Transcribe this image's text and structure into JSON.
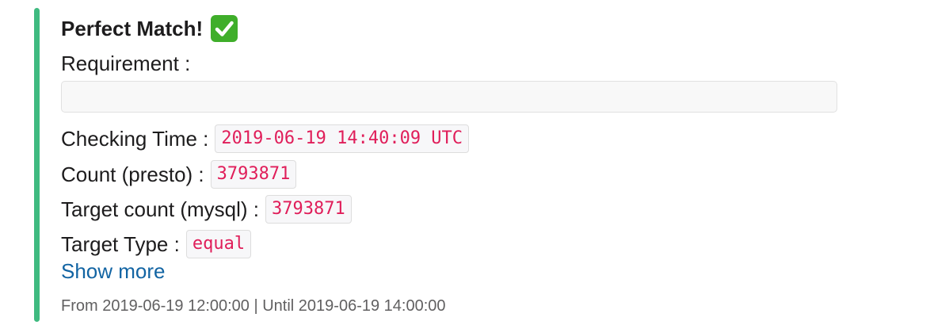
{
  "attachment": {
    "accent_color": "#3fba80",
    "title": "Perfect Match!",
    "title_icon": "check-mark-button-icon",
    "requirement_label": "Requirement :",
    "requirement_value": "",
    "fields": [
      {
        "label": "Checking Time :",
        "value": "2019-06-19 14:40:09 UTC"
      },
      {
        "label": "Count (presto) :",
        "value": "3793871"
      },
      {
        "label": "Target count (mysql) :",
        "value": "3793871"
      },
      {
        "label": "Target Type :",
        "value": "equal"
      }
    ],
    "show_more": "Show more",
    "footer": "From 2019-06-19 12:00:00 | Until 2019-06-19 14:00:00"
  }
}
